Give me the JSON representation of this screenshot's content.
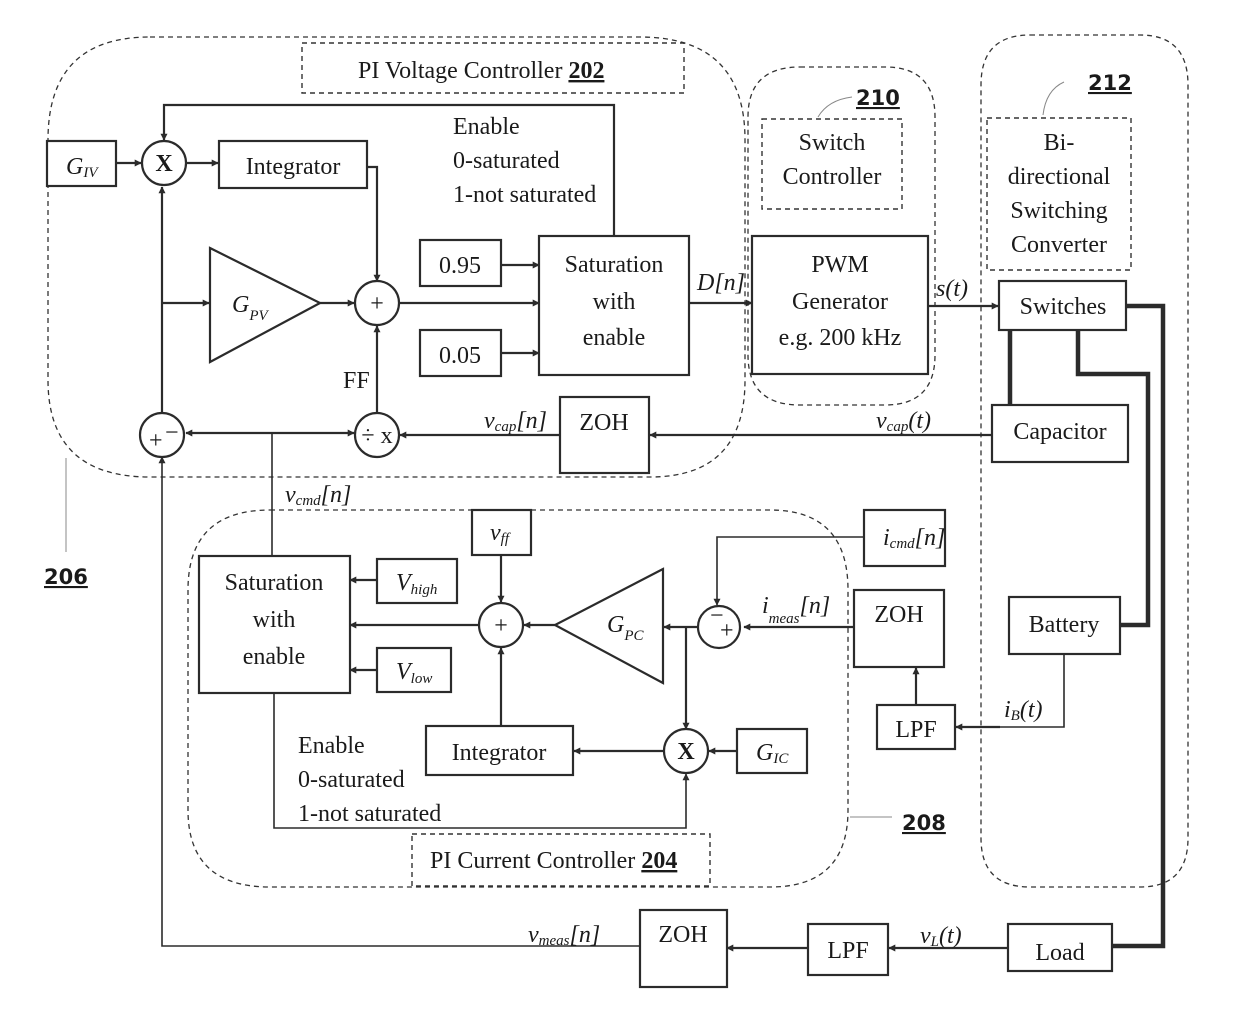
{
  "figure": {
    "groups": {
      "voltage_controller": {
        "title": "PI Voltage Controller ",
        "ref": "202"
      },
      "current_controller": {
        "title": "PI Current Controller ",
        "ref": "204"
      },
      "outer_ref": "206",
      "inner_ref": "208",
      "switch_controller": {
        "title_line1": "Switch",
        "title_line2": "Controller",
        "ref": "210"
      },
      "converter": {
        "title_line1": "Bi-",
        "title_line2": "directional",
        "title_line3": "Switching",
        "title_line4": "Converter",
        "ref": "212"
      }
    },
    "blocks": {
      "giv": {
        "main": "G",
        "sub": "IV"
      },
      "multiplier_top": "X",
      "integrator_top": "Integrator",
      "gpv": {
        "main": "G",
        "sub": "PV"
      },
      "sum_top": "+",
      "const_high": "0.95",
      "const_low": "0.05",
      "sat_top": {
        "line1": "Saturation",
        "line2": "with",
        "line3": "enable"
      },
      "enable_top": {
        "line1": "Enable",
        "line2": "0-saturated",
        "line3": "1-not saturated"
      },
      "ff_label": "FF",
      "divider": "÷ x",
      "error_sum": {
        "plus": "+",
        "minus": "−"
      },
      "zoh_cap": "ZOH",
      "pwm": {
        "line1": "PWM",
        "line2": "Generator",
        "line3": "e.g. 200 kHz"
      },
      "switches": "Switches",
      "capacitor": "Capacitor",
      "battery": "Battery",
      "load": "Load",
      "sat_bottom": {
        "line1": "Saturation",
        "line2": "with",
        "line3": "enable"
      },
      "vhigh": {
        "main": "V",
        "sub": "high"
      },
      "vlow": {
        "main": "V",
        "sub": "low"
      },
      "vff": {
        "main": "v",
        "sub": "ff"
      },
      "sum_bottom": "+",
      "gpc": {
        "main": "G",
        "sub": "PC"
      },
      "current_error": {
        "minus": "−",
        "plus": "+"
      },
      "icmd": {
        "main": "i",
        "sub": "cmd",
        "tail": "[n]"
      },
      "zoh_i": "ZOH",
      "lpf_i": "LPF",
      "multiplier_bottom": "X",
      "gic": {
        "main": "G",
        "sub": "IC"
      },
      "integrator_bottom": "Integrator",
      "enable_bottom": {
        "line1": "Enable",
        "line2": "0-saturated",
        "line3": "1-not saturated"
      },
      "zoh_v": "ZOH",
      "lpf_v": "LPF"
    },
    "signals": {
      "dn": "D[n]",
      "st": "s(t)",
      "vcap_n": {
        "main": "v",
        "sub": "cap",
        "tail": "[n]"
      },
      "vcap_t": {
        "main": "v",
        "sub": "cap",
        "tail": "(t)"
      },
      "vcmd_n": {
        "main": "v",
        "sub": "cmd",
        "tail": "[n]"
      },
      "imeas_n": {
        "main": "i",
        "sub": "meas",
        "tail": "[n]"
      },
      "ib_t": {
        "main": "i",
        "sub": "B",
        "tail": "(t)"
      },
      "vl_t": {
        "main": "v",
        "sub": "L",
        "tail": "(t)"
      },
      "vmeas_n": {
        "main": "v",
        "sub": "meas",
        "tail": "[n]"
      }
    }
  }
}
